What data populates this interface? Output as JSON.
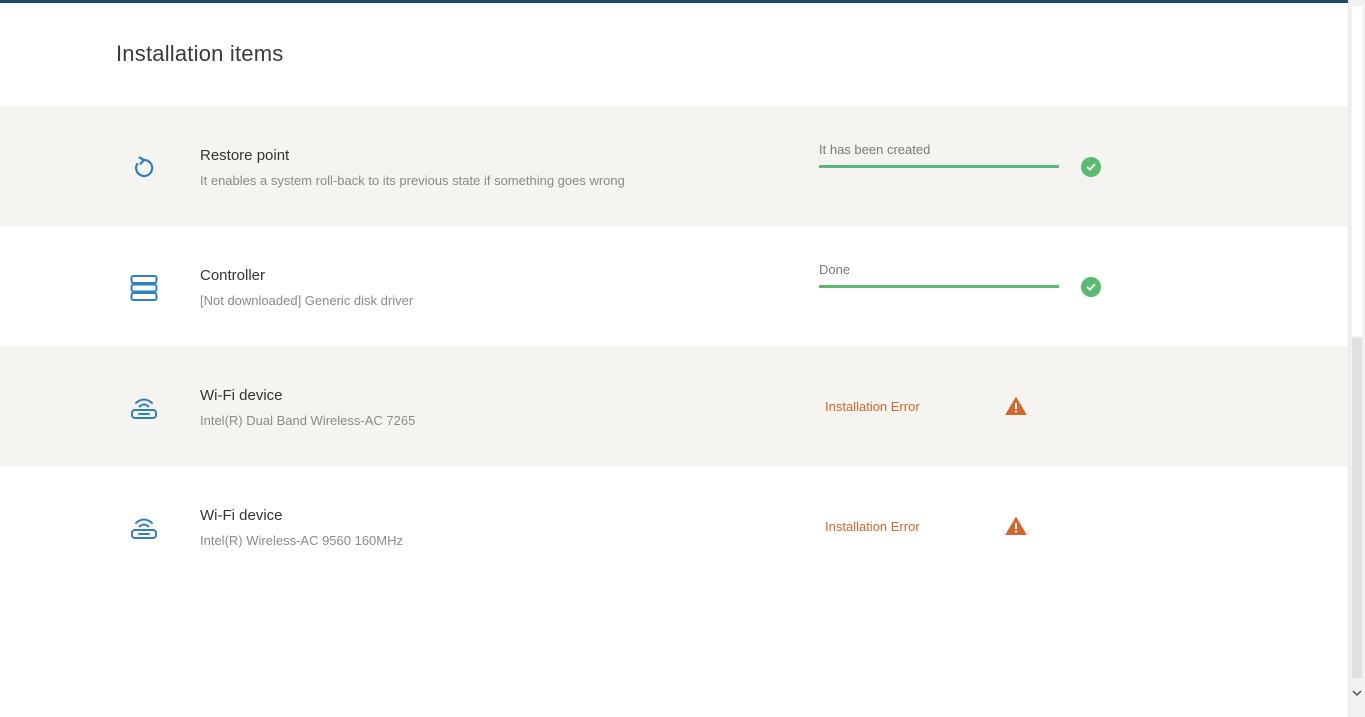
{
  "page": {
    "title": "Installation items"
  },
  "items": [
    {
      "name": "Restore point",
      "description": "It enables a system roll-back to its previous state if something goes wrong",
      "icon": "restore-icon",
      "status": "It has been created",
      "state": "success",
      "progress": 1.0
    },
    {
      "name": "Controller",
      "description": "[Not downloaded] Generic disk driver",
      "icon": "server-stack-icon",
      "status": "Done",
      "state": "success",
      "progress": 1.0
    },
    {
      "name": "Wi-Fi device",
      "description": "Intel(R) Dual Band Wireless-AC 7265",
      "icon": "wifi-router-icon",
      "status": "Installation Error",
      "state": "error"
    },
    {
      "name": "Wi-Fi device",
      "description": "Intel(R) Wireless-AC 9560 160MHz",
      "icon": "wifi-router-icon",
      "status": "Installation Error",
      "state": "error"
    }
  ],
  "colors": {
    "accent": "#1d4a6b",
    "icon": "#2f7fc1",
    "success": "#5cb971",
    "error": "#d2672c",
    "row_shade": "#f5f4f1"
  }
}
